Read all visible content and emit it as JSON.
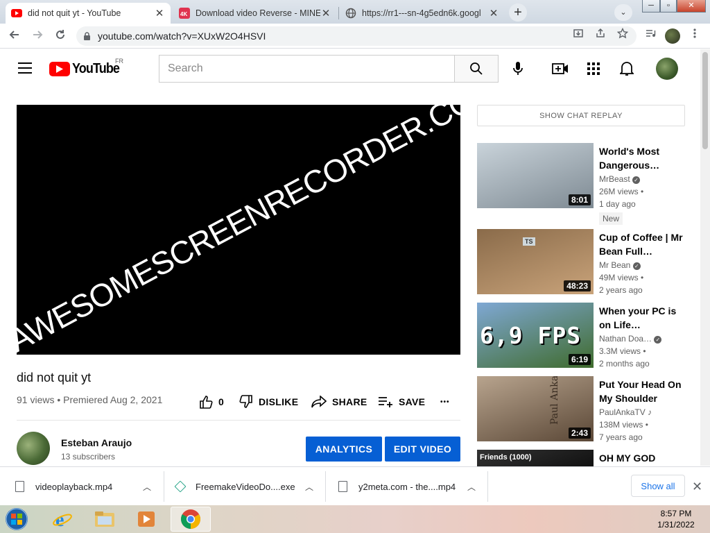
{
  "tabs": [
    {
      "title": "did not quit yt - YouTube",
      "close": "✕"
    },
    {
      "title": "Download video Reverse - MINE",
      "close": "✕"
    },
    {
      "title": "https://rr1---sn-4g5edn6k.googl",
      "close": "✕"
    }
  ],
  "new_tab": "+",
  "tab_search": "⌄",
  "window_buttons": [
    "─",
    "▫",
    "✕"
  ],
  "address_bar": {
    "url": "youtube.com/watch?v=XUxW2O4HSVI"
  },
  "youtube": {
    "logo_text": "YouTube",
    "country_code": "FR",
    "search_placeholder": "Search"
  },
  "video": {
    "watermark": "AWESOMESCREENRECORDER.COM",
    "title": "did not quit yt",
    "meta": "91 views • Premiered Aug 2, 2021",
    "likes": "0",
    "dislike_label": "DISLIKE",
    "share_label": "SHARE",
    "save_label": "SAVE",
    "more": "•••"
  },
  "channel": {
    "name": "Esteban Araujo",
    "subscribers": "13 subscribers",
    "analytics_label": "ANALYTICS",
    "edit_label": "EDIT VIDEO"
  },
  "chat_replay": "SHOW CHAT REPLAY",
  "recommendations": [
    {
      "title": "World's Most Dangerous…",
      "channel": "MrBeast",
      "views": "26M views •",
      "age": "1 day ago",
      "duration": "8:01",
      "badge": "New",
      "colors": [
        "#c9d3da",
        "#7e8a93"
      ]
    },
    {
      "title": "Cup of Coffee | Mr Bean Full…",
      "channel": "Mr Bean",
      "views": "49M views •",
      "age": "2 years ago",
      "duration": "48:23",
      "thumb_text": "TS",
      "colors": [
        "#8a6b4a",
        "#c9a37a"
      ]
    },
    {
      "title": "When your PC is on Life…",
      "channel": "Nathan Doa…",
      "views": "3.3M views •",
      "age": "2 months ago",
      "duration": "6:19",
      "thumb_text": "6,9 FPS",
      "colors": [
        "#7fa8d4",
        "#3f6b2c"
      ]
    },
    {
      "title": "Put Your Head On My Shoulder",
      "channel": "PaulAnkaTV",
      "views": "138M views •",
      "age": "7 years ago",
      "duration": "2:43",
      "thumb_text": "Paul Anka",
      "colors": [
        "#b8a48e",
        "#5a4736"
      ]
    },
    {
      "title": "OH MY GOD",
      "thumb_text": "Friends (1000)",
      "colors": [
        "#333333",
        "#111111"
      ]
    }
  ],
  "downloads": [
    {
      "name": "videoplayback.mp4"
    },
    {
      "name": "FreemakeVideoDo....exe"
    },
    {
      "name": "y2meta.com - the....mp4"
    }
  ],
  "show_all": "Show all",
  "download_close": "✕",
  "clock": {
    "time": "8:57 PM",
    "date": "1/31/2022"
  },
  "accent": {
    "youtube_red": "#ff0000",
    "button_blue": "#065fd4"
  }
}
